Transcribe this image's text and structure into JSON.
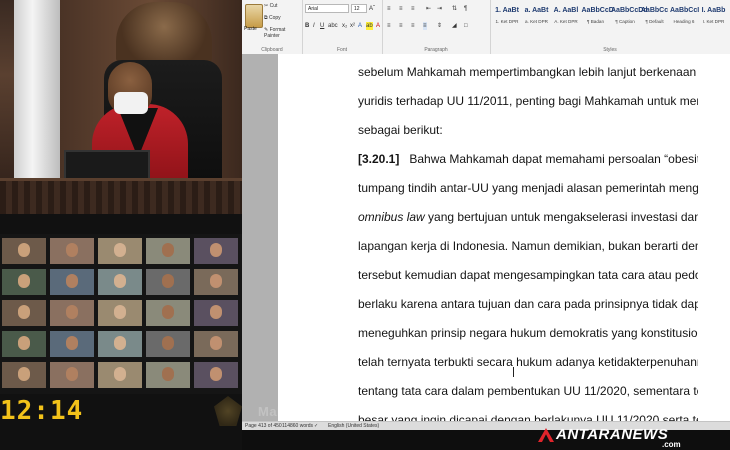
{
  "ribbon": {
    "clipboard": {
      "paste": "Paste",
      "cut": "Cut",
      "copy": "Copy",
      "format_painter": "Format Painter",
      "label": "Clipboard"
    },
    "font": {
      "name": "Arial",
      "size": "12",
      "label": "Font"
    },
    "paragraph": {
      "label": "Paragraph"
    },
    "styles": {
      "label": "Styles",
      "items": [
        {
          "preview": "1. AaBt",
          "name": "1. Ket DPR"
        },
        {
          "preview": "a. AaBt",
          "name": "a. Ket DPR"
        },
        {
          "preview": "A. AaBl",
          "name": "A. Ket DPR"
        },
        {
          "preview": "AaBbCcD",
          "name": "¶ Badan"
        },
        {
          "preview": "AaBbCcDd",
          "name": "¶ Caption"
        },
        {
          "preview": "AaBbCc",
          "name": "¶ Default"
        },
        {
          "preview": "AaBbCcI",
          "name": "Heading 6"
        },
        {
          "preview": "I. AaBb",
          "name": "I. Ket DPR"
        }
      ]
    }
  },
  "document": {
    "lines": [
      "sebelum Mahkamah mempertimbangkan lebih lanjut berkenaan dengan akibat",
      "yuridis terhadap UU 11/2011, penting bagi Mahkamah untuk menegaskan hal-hal,",
      "sebagai berikut:"
    ],
    "para_number": "[3.20.1]",
    "para_first_line": "Bahwa Mahkamah dapat memahami persoalan “obesitas regulasi” dan",
    "para_lines": [
      "tumpang tindih antar-UU yang menjadi alasan pemerintah menggunakan metode"
    ],
    "italic_phrase": "omnibus law",
    "after_italic": " yang bertujuan untuk mengakselerasi investasi dan memperluas",
    "para_rest": [
      "lapangan kerja di Indonesia. Namun demikian, bukan berarti demi mencapai tujuan",
      "tersebut kemudian dapat mengesampingkan tata cara atau pedoman baku yang",
      "berlaku karena antara tujuan dan cara pada prinsipnya tidak dapat dipisahkan dalam",
      "meneguhkan prinsip negara hukum demokratis yang konstitusional. Oleh karena",
      "telah ternyata terbukti secara hukum adanya ketidakterpenuhannya syarat-syarat",
      "tentang tata cara dalam pembentukan UU 11/2020, sementara terdapat pula tujuan",
      "besar yang ingin dicapai dengan berlakunya UU 11/2020 serta telah banyak"
    ]
  },
  "statusbar": {
    "page": "Page 413 of 450",
    "words": "114860 words",
    "language": "English (United States)"
  },
  "video": {
    "clock": "12:14"
  },
  "overlay": {
    "watermark": "Mahkamah",
    "logo_text": "ANTARANEWS",
    "logo_sub": ".com"
  },
  "colors": {
    "clock": "#f2c21a",
    "judge_robe": "#c0222a",
    "logo_accent": "#e0242b"
  }
}
